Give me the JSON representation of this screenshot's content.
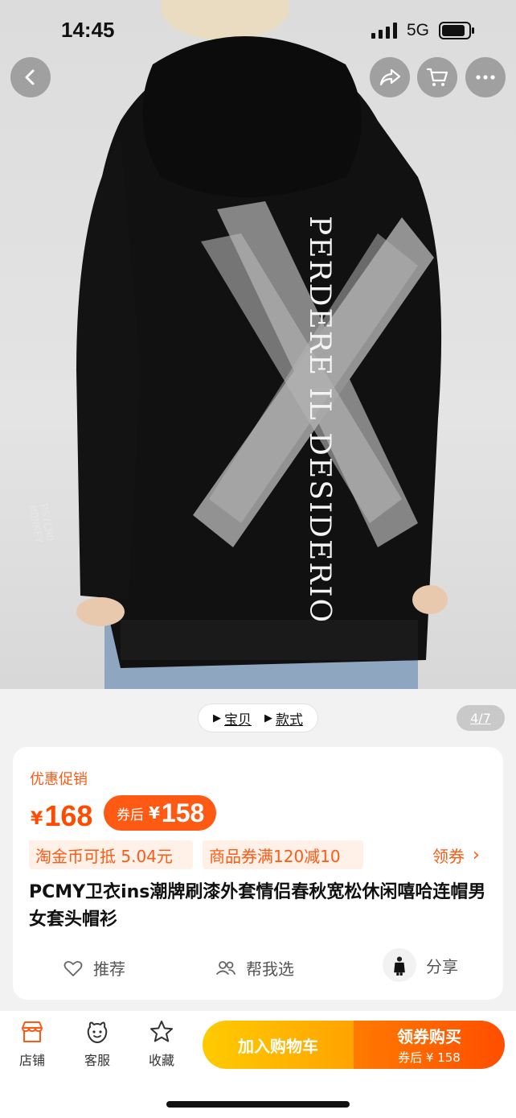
{
  "status_bar": {
    "time": "14:45",
    "network": "5G"
  },
  "product_image": {
    "back_print_text": "PERDERE IL DESIDERIO",
    "sleeve_print_lines": [
      "PSYCHO",
      "MONKEY"
    ],
    "counter": "4/7"
  },
  "image_tabs": [
    {
      "label": "宝贝"
    },
    {
      "label": "款式"
    }
  ],
  "nav_icons": [
    "back-arrow-icon",
    "share-icon",
    "cart-icon",
    "more-icon"
  ],
  "promo": {
    "label": "优惠促销",
    "currency": "¥",
    "price": "168",
    "coupon_label": "券后",
    "coupon_currency": "¥",
    "coupon_price": "158"
  },
  "tags": {
    "coins": "淘金币可抵 5.04元",
    "coupon": "商品券满120减10",
    "claim": "领券",
    "claim_chevron": "›"
  },
  "title": "PCMY卫衣ins潮牌刷漆外套情侣春秋宽松休闲嘻哈连帽男女套头帽衫",
  "actions": {
    "recommend": "推荐",
    "help_choose": "帮我选",
    "share": "分享"
  },
  "bottom_bar": {
    "shop": "店铺",
    "service": "客服",
    "favorite": "收藏",
    "add_to_cart": "加入购物车",
    "buy_main": "领券购买",
    "buy_sub": "券后 ¥ 158"
  },
  "colors": {
    "accent": "#ff5a14",
    "cart_button": "#ffb400",
    "buy_button": "#ff5a00"
  }
}
